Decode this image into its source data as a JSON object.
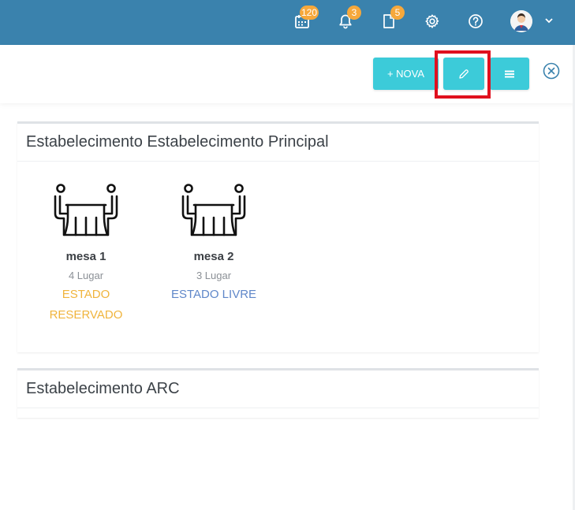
{
  "topbar": {
    "calendar_badge": "120",
    "notifications_badge": "3",
    "documents_badge": "5"
  },
  "toolbar": {
    "new_label": "+ NOVA"
  },
  "sections": [
    {
      "title": "Estabelecimento Estabelecimento Principal",
      "tables": [
        {
          "name": "mesa 1",
          "seats": "4 Lugar",
          "status_line1": "ESTADO",
          "status_line2": "RESERVADO",
          "status_color": "#f0b43c"
        },
        {
          "name": "mesa 2",
          "seats": "3 Lugar",
          "status_line1": "ESTADO LIVRE",
          "status_line2": "",
          "status_color": "#5f87c9"
        }
      ]
    },
    {
      "title": "Estabelecimento ARC",
      "tables": []
    }
  ],
  "colors": {
    "topbar": "#3a82ad",
    "button": "#3ccbd9",
    "badge": "#f6a83b",
    "highlight": "#e0101e"
  }
}
